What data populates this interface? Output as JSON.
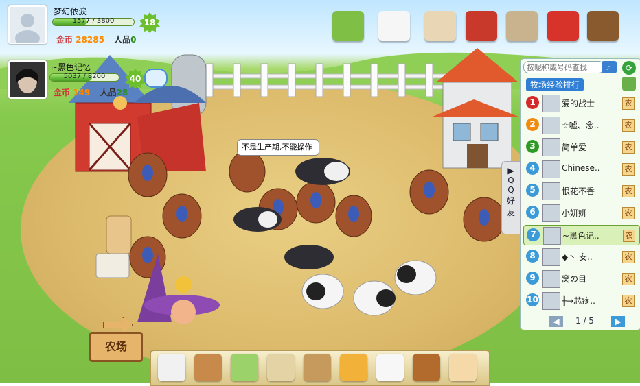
{
  "player": {
    "name": "梦幻依涙",
    "exp": "1577 / 3800",
    "exp_ratio": 0.415,
    "level": "18",
    "coins_label": "金币",
    "coins": "28285",
    "rep_label": "人品",
    "rep": "0"
  },
  "visitor": {
    "name": "~黑色记忆",
    "exp": "5037 / 8200",
    "exp_ratio": 0.614,
    "level": "40",
    "coins_label": "金币",
    "coins": "149",
    "rep_label": "人品",
    "rep": "28"
  },
  "bubble": "不是生产期,不能操作",
  "search_placeholder": "按昵称或号码查找",
  "rank_title": "牧场经验排行",
  "qq_tab": [
    "Q",
    "Q",
    "好",
    "友"
  ],
  "friends": [
    {
      "rank": "1",
      "name": "爱的战士",
      "color": "#d42a2a",
      "farm": "农"
    },
    {
      "rank": "2",
      "name": "☆嘘、念..",
      "color": "#f08a10",
      "farm": "农"
    },
    {
      "rank": "3",
      "name": "简单爱",
      "color": "#2f9a26",
      "farm": "农"
    },
    {
      "rank": "4",
      "name": "Chinese..",
      "color": "#3b9ad8",
      "farm": "农"
    },
    {
      "rank": "5",
      "name": "恨花不香",
      "color": "#3b9ad8",
      "farm": "农"
    },
    {
      "rank": "6",
      "name": "小妍妍",
      "color": "#3b9ad8",
      "farm": "农"
    },
    {
      "rank": "7",
      "name": "~黑色记..",
      "color": "#3b9ad8",
      "farm": "农"
    },
    {
      "rank": "8",
      "name": "◆丶 安..",
      "color": "#3b9ad8",
      "farm": "农"
    },
    {
      "rank": "9",
      "name": "窝の目",
      "color": "#3b9ad8",
      "farm": "农"
    },
    {
      "rank": "10",
      "name": "╂→芯疼..",
      "color": "#3b9ad8",
      "farm": "农"
    }
  ],
  "pager": "1 / 5",
  "sign": "农场",
  "top_icons": [
    "farm-plot-icon",
    "cow-shop-icon",
    "new-item-icon",
    "barn-icon",
    "warehouse-icon",
    "shop-icon",
    "new-decor-icon"
  ],
  "tools": [
    "cursor-icon",
    "seed-bag-icon",
    "pest-icon",
    "net-icon",
    "broom-icon",
    "harvest-box-icon",
    "glove-icon",
    "paw-icon",
    "hand-icon"
  ]
}
